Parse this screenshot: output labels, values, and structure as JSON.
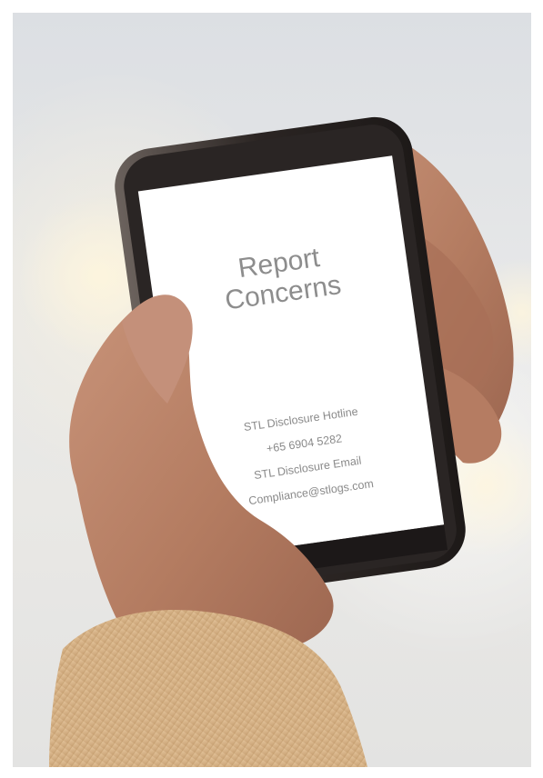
{
  "screen": {
    "title_line1": "Report",
    "title_line2": "Concerns",
    "hotline_label": "STL Disclosure Hotline",
    "hotline_number": "+65 6904 5282",
    "email_label": "STL Disclosure Email",
    "email_address": "Compliance@stlogs.com"
  },
  "colors": {
    "phone_body": "#2a2524",
    "screen_background": "#ffffff",
    "skin": "#b9836a",
    "sleeve": "#d8b488",
    "background": "#e4e5e6",
    "screen_text": "#8c8c8c"
  }
}
